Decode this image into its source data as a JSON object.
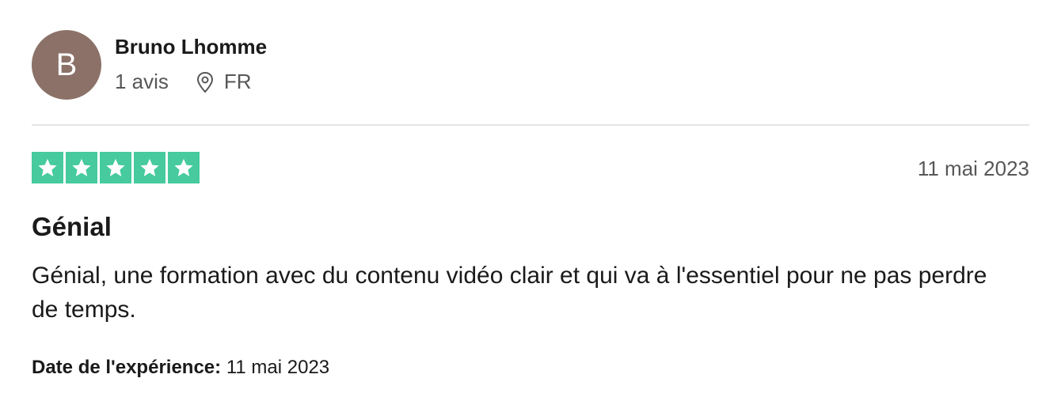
{
  "reviewer": {
    "avatar_letter": "B",
    "avatar_color": "#8b7168",
    "name": "Bruno Lhomme",
    "review_count": "1 avis",
    "location_icon": "location-pin-icon",
    "country": "FR"
  },
  "review": {
    "rating": 5,
    "rating_max": 5,
    "star_color": "#00b67a",
    "date": "11 mai 2023",
    "title": "Génial",
    "body": "Génial, une formation avec du contenu vidéo clair et qui va à l'essentiel pour ne pas perdre de temps.",
    "experience_label": "Date de l'expérience:",
    "experience_date": "11 mai 2023"
  }
}
